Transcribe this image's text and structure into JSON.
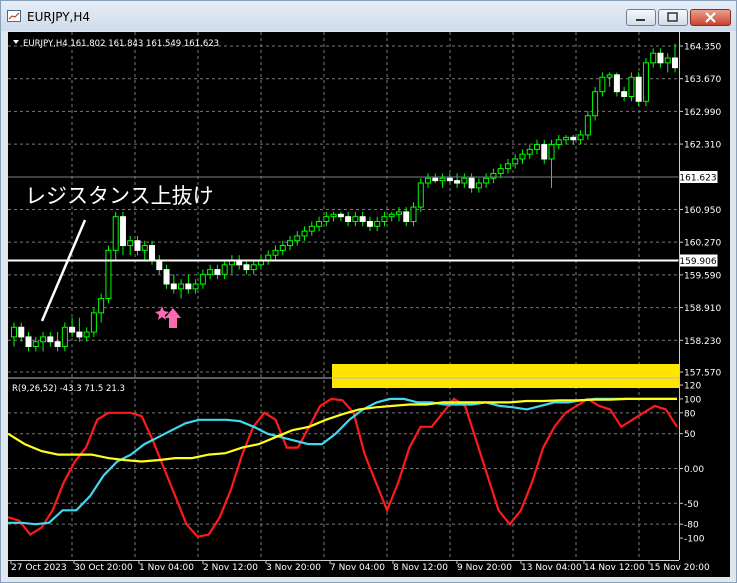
{
  "window": {
    "title": "EURJPY,H4"
  },
  "chart_data": [
    {
      "type": "candlestick",
      "info_label": "EURJPY,H4  161.802 161.843 161.549 161.623",
      "price_ticks": [
        "164.350",
        "163.670",
        "162.990",
        "162.310",
        "161.623",
        "160.950",
        "160.270",
        "159.906",
        "159.590",
        "158.910",
        "158.230",
        "157.570"
      ],
      "current_price": "161.623",
      "hline_price": "159.906",
      "annotation": "レジスタンス上抜け",
      "time_labels": [
        "27 Oct 2023",
        "30 Oct 20:00",
        "1 Nov 04:00",
        "2 Nov 12:00",
        "3 Nov 20:00",
        "7 Nov 04:00",
        "8 Nov 12:00",
        "9 Nov 20:00",
        "13 Nov 04:00",
        "14 Nov 12:00",
        "15 Nov 20:00"
      ],
      "ohlc": [
        [
          158.3,
          158.6,
          158.1,
          158.5
        ],
        [
          158.5,
          158.6,
          158.2,
          158.3
        ],
        [
          158.3,
          158.4,
          158.0,
          158.1
        ],
        [
          158.1,
          158.3,
          158.0,
          158.2
        ],
        [
          158.2,
          158.4,
          158.0,
          158.3
        ],
        [
          158.3,
          158.4,
          158.1,
          158.2
        ],
        [
          158.2,
          158.4,
          158.0,
          158.1
        ],
        [
          158.1,
          158.6,
          158.0,
          158.5
        ],
        [
          158.5,
          158.7,
          158.3,
          158.4
        ],
        [
          158.4,
          158.7,
          158.2,
          158.3
        ],
        [
          158.3,
          158.5,
          158.2,
          158.4
        ],
        [
          158.4,
          158.9,
          158.3,
          158.8
        ],
        [
          158.8,
          159.2,
          158.6,
          159.1
        ],
        [
          159.1,
          160.2,
          159.0,
          160.1
        ],
        [
          160.1,
          160.9,
          159.9,
          160.8
        ],
        [
          160.8,
          160.9,
          160.0,
          160.2
        ],
        [
          160.2,
          160.4,
          160.0,
          160.3
        ],
        [
          160.3,
          160.4,
          160.0,
          160.1
        ],
        [
          160.1,
          160.3,
          159.9,
          160.2
        ],
        [
          160.2,
          160.3,
          159.8,
          159.9
        ],
        [
          159.9,
          160.0,
          159.6,
          159.7
        ],
        [
          159.7,
          159.8,
          159.3,
          159.4
        ],
        [
          159.4,
          159.6,
          159.2,
          159.3
        ],
        [
          159.3,
          159.5,
          159.1,
          159.4
        ],
        [
          159.4,
          159.6,
          159.2,
          159.3
        ],
        [
          159.3,
          159.5,
          159.2,
          159.4
        ],
        [
          159.4,
          159.7,
          159.3,
          159.6
        ],
        [
          159.6,
          159.8,
          159.5,
          159.7
        ],
        [
          159.7,
          159.8,
          159.5,
          159.6
        ],
        [
          159.6,
          159.9,
          159.5,
          159.8
        ],
        [
          159.8,
          160.0,
          159.6,
          159.9
        ],
        [
          159.9,
          160.0,
          159.7,
          159.8
        ],
        [
          159.8,
          159.9,
          159.6,
          159.7
        ],
        [
          159.7,
          159.9,
          159.6,
          159.8
        ],
        [
          159.8,
          160.0,
          159.7,
          159.9
        ],
        [
          159.9,
          160.1,
          159.8,
          160.0
        ],
        [
          160.0,
          160.2,
          159.9,
          160.1
        ],
        [
          160.1,
          160.3,
          160.0,
          160.2
        ],
        [
          160.2,
          160.4,
          160.1,
          160.3
        ],
        [
          160.3,
          160.5,
          160.2,
          160.4
        ],
        [
          160.4,
          160.6,
          160.3,
          160.5
        ],
        [
          160.5,
          160.7,
          160.4,
          160.6
        ],
        [
          160.6,
          160.8,
          160.5,
          160.7
        ],
        [
          160.7,
          160.9,
          160.6,
          160.8
        ],
        [
          160.8,
          160.9,
          160.7,
          160.85
        ],
        [
          160.85,
          160.9,
          160.7,
          160.8
        ],
        [
          160.8,
          160.9,
          160.6,
          160.7
        ],
        [
          160.7,
          160.9,
          160.6,
          160.8
        ],
        [
          160.8,
          160.9,
          160.6,
          160.7
        ],
        [
          160.7,
          160.8,
          160.5,
          160.6
        ],
        [
          160.6,
          160.8,
          160.5,
          160.7
        ],
        [
          160.7,
          160.9,
          160.6,
          160.8
        ],
        [
          160.8,
          160.9,
          160.7,
          160.85
        ],
        [
          160.85,
          161.0,
          160.7,
          160.9
        ],
        [
          160.9,
          161.0,
          160.6,
          160.7
        ],
        [
          160.7,
          161.1,
          160.6,
          161.0
        ],
        [
          161.0,
          161.6,
          160.9,
          161.5
        ],
        [
          161.5,
          161.7,
          161.4,
          161.6
        ],
        [
          161.6,
          161.7,
          161.5,
          161.55
        ],
        [
          161.55,
          161.7,
          161.4,
          161.6
        ],
        [
          161.6,
          161.7,
          161.5,
          161.55
        ],
        [
          161.55,
          161.7,
          161.4,
          161.5
        ],
        [
          161.5,
          161.7,
          161.4,
          161.6
        ],
        [
          161.6,
          161.7,
          161.3,
          161.4
        ],
        [
          161.4,
          161.6,
          161.3,
          161.5
        ],
        [
          161.5,
          161.7,
          161.4,
          161.6
        ],
        [
          161.6,
          161.8,
          161.5,
          161.7
        ],
        [
          161.7,
          161.9,
          161.6,
          161.8
        ],
        [
          161.8,
          162.0,
          161.7,
          161.9
        ],
        [
          161.9,
          162.1,
          161.8,
          162.0
        ],
        [
          162.0,
          162.2,
          161.9,
          162.1
        ],
        [
          162.1,
          162.3,
          162.0,
          162.2
        ],
        [
          162.2,
          162.4,
          162.1,
          162.3
        ],
        [
          162.3,
          162.4,
          161.9,
          162.0
        ],
        [
          162.0,
          162.4,
          161.4,
          162.3
        ],
        [
          162.3,
          162.5,
          162.2,
          162.4
        ],
        [
          162.4,
          162.5,
          162.3,
          162.45
        ],
        [
          162.45,
          162.5,
          162.3,
          162.4
        ],
        [
          162.4,
          162.6,
          162.3,
          162.5
        ],
        [
          162.5,
          163.0,
          162.4,
          162.9
        ],
        [
          162.9,
          163.5,
          162.8,
          163.4
        ],
        [
          163.4,
          163.8,
          163.3,
          163.7
        ],
        [
          163.7,
          163.8,
          163.5,
          163.75
        ],
        [
          163.75,
          163.8,
          163.3,
          163.4
        ],
        [
          163.4,
          163.5,
          163.2,
          163.3
        ],
        [
          163.3,
          163.8,
          163.2,
          163.7
        ],
        [
          163.7,
          163.8,
          163.1,
          163.2
        ],
        [
          163.2,
          164.1,
          163.1,
          164.0
        ],
        [
          164.0,
          164.3,
          163.9,
          164.2
        ],
        [
          164.2,
          164.3,
          163.9,
          164.0
        ],
        [
          164.0,
          164.2,
          163.8,
          164.1
        ],
        [
          164.1,
          164.4,
          163.8,
          163.9
        ]
      ]
    },
    {
      "type": "line",
      "info_label": "R(9,26,52) -43.3 71.5 21.3",
      "ylim": [
        -120,
        120
      ],
      "ticks": [
        "120",
        "100",
        "80",
        "50",
        "0.00",
        "-50",
        "-80",
        "-100"
      ],
      "series": [
        {
          "color": "#ff1a1a",
          "values": [
            -70,
            -75,
            -95,
            -85,
            -60,
            -20,
            10,
            30,
            70,
            80,
            80,
            80,
            75,
            40,
            0,
            -40,
            -80,
            -98,
            -95,
            -70,
            -30,
            20,
            60,
            80,
            70,
            30,
            30,
            60,
            90,
            100,
            98,
            80,
            20,
            -20,
            -60,
            -20,
            30,
            60,
            60,
            80,
            100,
            90,
            40,
            -10,
            -60,
            -80,
            -60,
            -20,
            30,
            60,
            80,
            90,
            100,
            90,
            85,
            60,
            70,
            80,
            90,
            85,
            60
          ]
        },
        {
          "color": "#3fd9f0",
          "values": [
            -78,
            -78,
            -80,
            -78,
            -60,
            -60,
            -40,
            -10,
            10,
            20,
            35,
            45,
            55,
            65,
            70,
            70,
            70,
            68,
            60,
            50,
            45,
            40,
            35,
            35,
            50,
            70,
            85,
            95,
            100,
            100,
            95,
            95,
            92,
            92,
            92,
            95,
            90,
            88,
            85,
            90,
            95,
            95,
            98,
            100,
            100,
            100,
            100,
            100,
            100,
            100
          ]
        },
        {
          "color": "#ffff1a",
          "values": [
            50,
            35,
            25,
            20,
            20,
            20,
            15,
            12,
            10,
            12,
            15,
            15,
            20,
            22,
            30,
            35,
            45,
            55,
            60,
            70,
            78,
            85,
            88,
            90,
            92,
            92,
            95,
            95,
            95,
            95,
            95,
            97,
            97,
            98,
            98,
            99,
            99,
            100,
            100,
            100,
            100
          ]
        }
      ]
    }
  ]
}
